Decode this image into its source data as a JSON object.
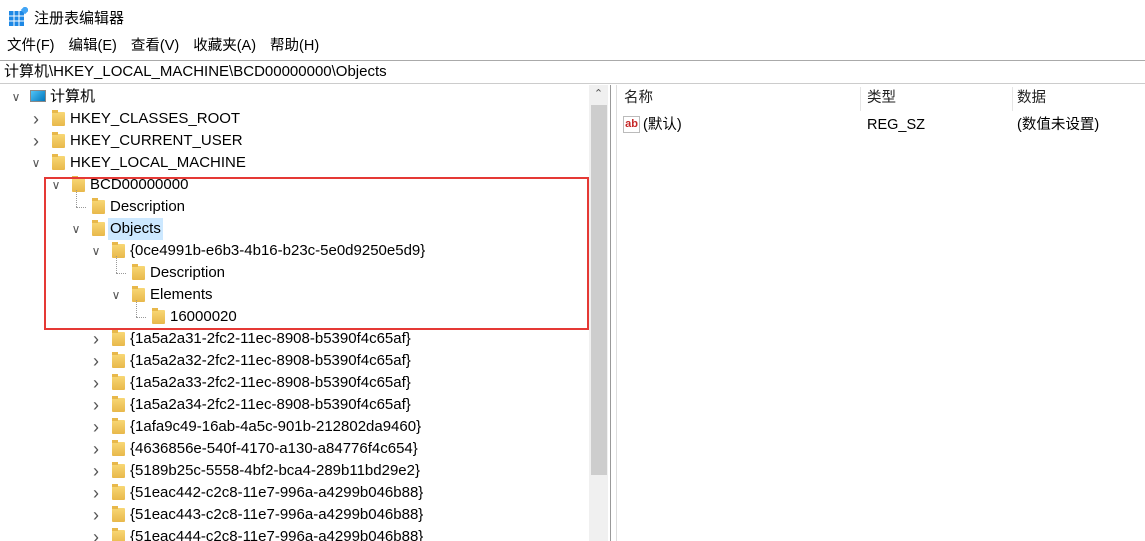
{
  "window": {
    "title": "注册表编辑器",
    "icon": "regedit-icon"
  },
  "menu": [
    "文件(F)",
    "编辑(E)",
    "查看(V)",
    "收藏夹(A)",
    "帮助(H)"
  ],
  "address": "计算机\\HKEY_LOCAL_MACHINE\\BCD00000000\\Objects",
  "tree": [
    {
      "label": "计算机",
      "level": 0,
      "state": "expanded",
      "icon": "computer-icon"
    },
    {
      "label": "HKEY_CLASSES_ROOT",
      "level": 1,
      "state": "collapsed"
    },
    {
      "label": "HKEY_CURRENT_USER",
      "level": 1,
      "state": "collapsed"
    },
    {
      "label": "HKEY_LOCAL_MACHINE",
      "level": 1,
      "state": "expanded"
    },
    {
      "label": "BCD00000000",
      "level": 2,
      "state": "expanded"
    },
    {
      "label": "Description",
      "level": 3,
      "state": "leaf"
    },
    {
      "label": "Objects",
      "level": 3,
      "state": "expanded",
      "selected": true
    },
    {
      "label": "{0ce4991b-e6b3-4b16-b23c-5e0d9250e5d9}",
      "level": 4,
      "state": "expanded"
    },
    {
      "label": "Description",
      "level": 5,
      "state": "leaf"
    },
    {
      "label": "Elements",
      "level": 5,
      "state": "expanded"
    },
    {
      "label": "16000020",
      "level": 6,
      "state": "leaf"
    },
    {
      "label": "{1a5a2a31-2fc2-11ec-8908-b5390f4c65af}",
      "level": 4,
      "state": "collapsed"
    },
    {
      "label": "{1a5a2a32-2fc2-11ec-8908-b5390f4c65af}",
      "level": 4,
      "state": "collapsed"
    },
    {
      "label": "{1a5a2a33-2fc2-11ec-8908-b5390f4c65af}",
      "level": 4,
      "state": "collapsed"
    },
    {
      "label": "{1a5a2a34-2fc2-11ec-8908-b5390f4c65af}",
      "level": 4,
      "state": "collapsed"
    },
    {
      "label": "{1afa9c49-16ab-4a5c-901b-212802da9460}",
      "level": 4,
      "state": "collapsed"
    },
    {
      "label": "{4636856e-540f-4170-a130-a84776f4c654}",
      "level": 4,
      "state": "collapsed"
    },
    {
      "label": "{5189b25c-5558-4bf2-bca4-289b11bd29e2}",
      "level": 4,
      "state": "collapsed"
    },
    {
      "label": "{51eac442-c2c8-11e7-996a-a4299b046b88}",
      "level": 4,
      "state": "collapsed"
    },
    {
      "label": "{51eac443-c2c8-11e7-996a-a4299b046b88}",
      "level": 4,
      "state": "collapsed"
    },
    {
      "label": "{51eac444-c2c8-11e7-996a-a4299b046b88}",
      "level": 4,
      "state": "collapsed"
    }
  ],
  "values": {
    "columns": [
      "名称",
      "类型",
      "数据"
    ],
    "rows": [
      {
        "name": "(默认)",
        "type": "REG_SZ",
        "data": "(数值未设置)",
        "icon": "string-value-icon"
      }
    ]
  },
  "highlight_color": "#e53935"
}
